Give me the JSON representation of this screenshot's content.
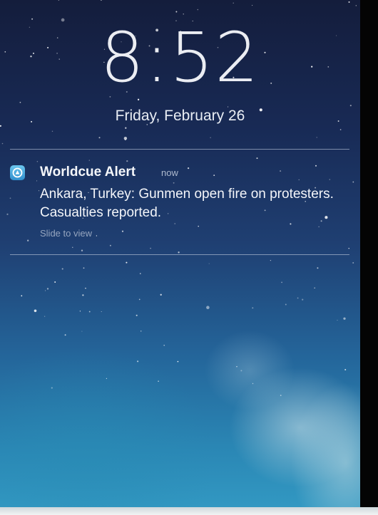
{
  "lock_screen": {
    "time": "8:52",
    "date": "Friday, February 26"
  },
  "notification": {
    "app_icon": "worldcue-app-icon",
    "app_name": "Worldcue Alert",
    "timestamp": "now",
    "message": "Ankara, Turkey: Gunmen open fire on protesters. Casualties reported.",
    "action_hint": "Slide to view"
  },
  "colors": {
    "sky_top": "#141d3c",
    "sky_bottom": "#3298c2",
    "app_icon": "#4aaee0"
  }
}
